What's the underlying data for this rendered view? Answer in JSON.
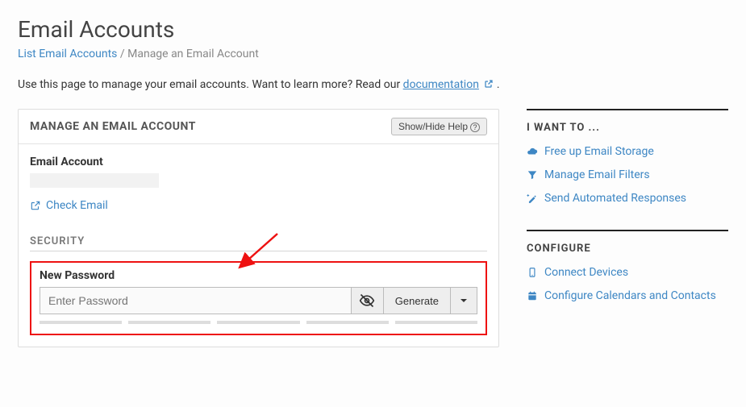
{
  "page": {
    "title": "Email Accounts",
    "breadcrumb_link": "List Email Accounts",
    "breadcrumb_current": "Manage an Email Account",
    "intro_prefix": "Use this page to manage your email accounts. Want to learn more? Read our ",
    "intro_link": "documentation",
    "intro_suffix": " ."
  },
  "panel": {
    "title": "MANAGE AN EMAIL ACCOUNT",
    "help_label": "Show/Hide Help",
    "email_label": "Email Account",
    "check_email": "Check Email"
  },
  "security": {
    "heading": "SECURITY",
    "new_password_label": "New Password",
    "password_placeholder": "Enter Password",
    "generate_label": "Generate"
  },
  "sidebar": {
    "want_title": "I WANT TO ...",
    "want_items": [
      {
        "label": "Free up Email Storage"
      },
      {
        "label": "Manage Email Filters"
      },
      {
        "label": "Send Automated Responses"
      }
    ],
    "configure_title": "CONFIGURE",
    "configure_items": [
      {
        "label": "Connect Devices"
      },
      {
        "label": "Configure Calendars and Contacts"
      }
    ]
  }
}
